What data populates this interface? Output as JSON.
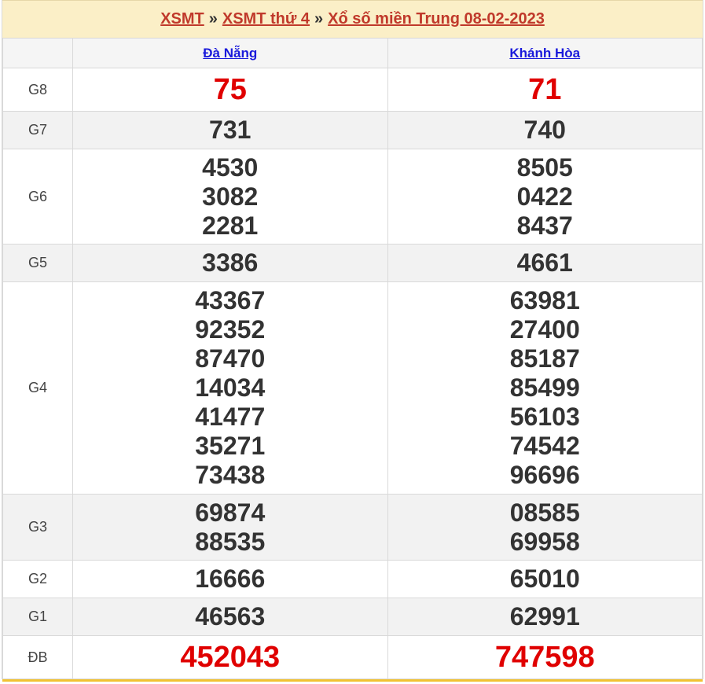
{
  "breadcrumb": {
    "link1": "XSMT",
    "sep1": "»",
    "link2": "XSMT thứ 4",
    "sep2": "»",
    "link3": "Xổ số miền Trung 08-02-2023"
  },
  "provinces": [
    "Đà Nẵng",
    "Khánh Hòa"
  ],
  "prizes": [
    {
      "label": "G8",
      "values": [
        [
          "75"
        ],
        [
          "71"
        ]
      ]
    },
    {
      "label": "G7",
      "values": [
        [
          "731"
        ],
        [
          "740"
        ]
      ]
    },
    {
      "label": "G6",
      "values": [
        [
          "4530",
          "3082",
          "2281"
        ],
        [
          "8505",
          "0422",
          "8437"
        ]
      ]
    },
    {
      "label": "G5",
      "values": [
        [
          "3386"
        ],
        [
          "4661"
        ]
      ]
    },
    {
      "label": "G4",
      "values": [
        [
          "43367",
          "92352",
          "87470",
          "14034",
          "41477",
          "35271",
          "73438"
        ],
        [
          "63981",
          "27400",
          "85187",
          "85499",
          "56103",
          "74542",
          "96696"
        ]
      ]
    },
    {
      "label": "G3",
      "values": [
        [
          "69874",
          "88535"
        ],
        [
          "08585",
          "69958"
        ]
      ]
    },
    {
      "label": "G2",
      "values": [
        [
          "16666"
        ],
        [
          "65010"
        ]
      ]
    },
    {
      "label": "G1",
      "values": [
        [
          "46563"
        ],
        [
          "62991"
        ]
      ]
    },
    {
      "label": "ĐB",
      "values": [
        [
          "452043"
        ],
        [
          "747598"
        ]
      ]
    }
  ],
  "colors": {
    "banner_bg": "#fbefc7",
    "banner_text": "#c0392b",
    "link_blue": "#1a1adb",
    "highlight_red": "#e00000",
    "alt_row_bg": "#f2f2f2"
  }
}
